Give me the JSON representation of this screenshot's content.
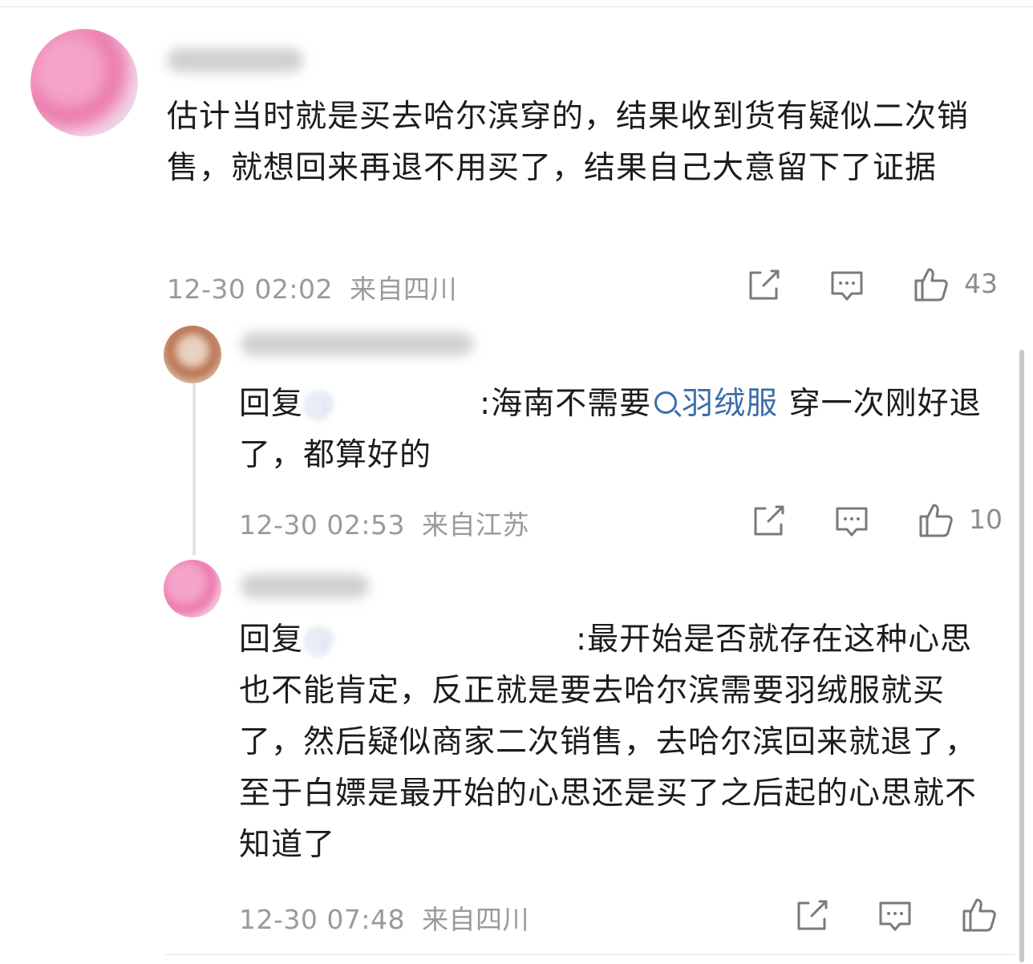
{
  "comment": {
    "text": "估计当时就是买去哈尔滨穿的，结果收到货有疑似二次销售，就想回来再退不用买了，结果自己大意留下了证据",
    "time": "12-30 02:02",
    "location": "来自四川",
    "like_count": "43"
  },
  "reply1": {
    "prefix": "回复",
    "mention": "@ ",
    "text_before": ":海南不需要",
    "topic": "羽绒服",
    "text_after": " 穿一次刚好退了，都算好的",
    "time": "12-30 02:53",
    "location": "来自江苏",
    "like_count": "10"
  },
  "reply2": {
    "prefix": "回复",
    "mention": "@ ",
    "text": ":最开始是否就存在这种心思也不能肯定，反正就是要去哈尔滨需要羽绒服就买了，然后疑似商家二次销售，去哈尔滨回来就退了，至于白嫖是最开始的心思还是买了之后起的心思就不知道了",
    "time": "12-30 07:48",
    "location": "来自四川",
    "like_count": ""
  },
  "colors": {
    "text": "#1c1c1c",
    "meta": "#9a9a9a",
    "link": "#3b6ea8",
    "icon": "#7a7a7a"
  },
  "icons": [
    "share-icon",
    "comment-icon",
    "like-icon",
    "search-icon"
  ]
}
